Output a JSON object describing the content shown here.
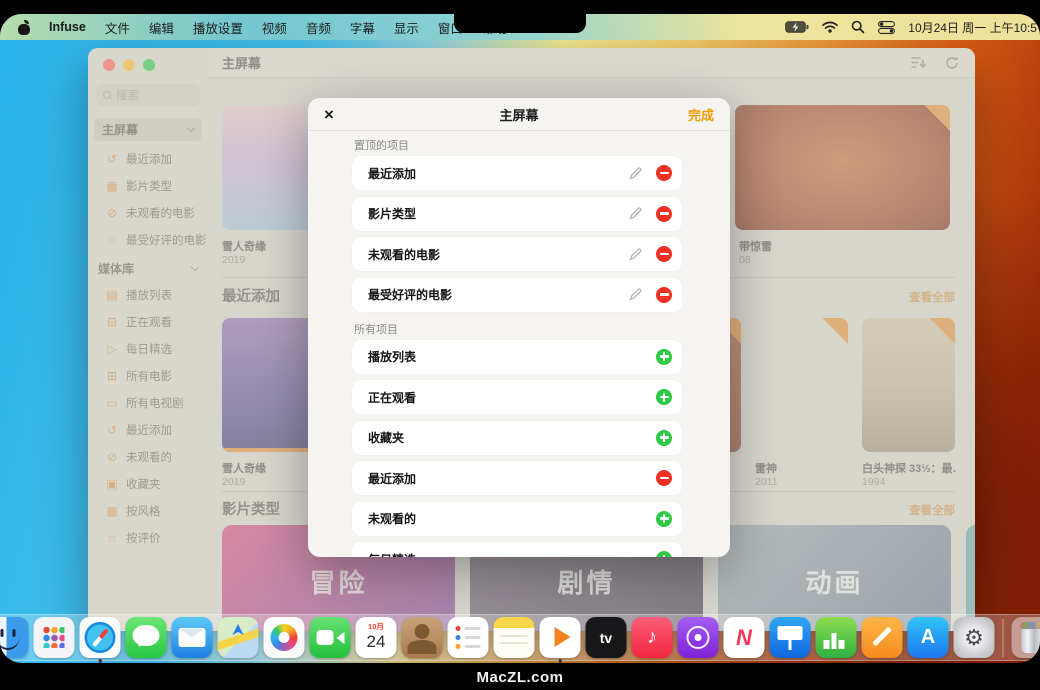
{
  "menu_bar": {
    "app_name": "Infuse",
    "menus": [
      "文件",
      "编辑",
      "播放设置",
      "视频",
      "音频",
      "字幕",
      "显示",
      "窗口",
      "帮助"
    ],
    "clock": "10月24日 周一 上午10:5"
  },
  "window": {
    "title": "主屏幕",
    "sidebar": {
      "search_placeholder": "搜索",
      "home_section": {
        "label": "主屏幕",
        "items": [
          {
            "icon": "clock-icon",
            "glyph": "↺",
            "label": "最近添加"
          },
          {
            "icon": "grid-icon",
            "glyph": "▦",
            "label": "影片类型"
          },
          {
            "icon": "eye-off-icon",
            "glyph": "⊘",
            "label": "未观看的电影"
          },
          {
            "icon": "star-icon",
            "glyph": "☆",
            "label": "最受好评的电影"
          }
        ]
      },
      "library_section": {
        "label": "媒体库",
        "items": [
          {
            "icon": "playlist-icon",
            "glyph": "▤",
            "label": "播放列表"
          },
          {
            "icon": "folder-icon",
            "glyph": "⊟",
            "label": "正在观看"
          },
          {
            "icon": "play-square-icon",
            "glyph": "▷",
            "label": "每日精选"
          },
          {
            "icon": "film-grid-icon",
            "glyph": "⊞",
            "label": "所有电影"
          },
          {
            "icon": "tv-icon",
            "glyph": "▭",
            "label": "所有电视剧"
          },
          {
            "icon": "clock-icon",
            "glyph": "↺",
            "label": "最近添加"
          },
          {
            "icon": "eye-off-icon",
            "glyph": "⊘",
            "label": "未观看的"
          },
          {
            "icon": "favorites-icon",
            "glyph": "▣",
            "label": "收藏夹"
          },
          {
            "icon": "genre-icon",
            "glyph": "▦",
            "label": "按风格"
          },
          {
            "icon": "rating-icon",
            "glyph": "☆",
            "label": "按评价"
          }
        ]
      }
    },
    "content": {
      "featured": [
        {
          "title": "雪人奇缘",
          "year": "2019"
        },
        {
          "title": "带惊雷",
          "year": "08"
        }
      ],
      "recent": {
        "heading": "最近添加",
        "link": "查看全部",
        "items": [
          {
            "title": "雪人奇缘",
            "year": "2019"
          },
          {
            "title": "雷神",
            "year": "2011"
          },
          {
            "title": "白头神探 33⅓：最…",
            "year": "1994"
          }
        ]
      },
      "genres": {
        "heading": "影片类型",
        "link": "查看全部",
        "categories": [
          "冒险",
          "剧情",
          "动画"
        ]
      }
    }
  },
  "modal": {
    "title": "主屏幕",
    "close_glyph": "×",
    "done_label": "完成",
    "pinned_section": "置顶的项目",
    "all_section": "所有项目",
    "pinned_items": [
      {
        "label": "最近添加",
        "action": "remove"
      },
      {
        "label": "影片类型",
        "action": "remove"
      },
      {
        "label": "未观看的电影",
        "action": "remove"
      },
      {
        "label": "最受好评的电影",
        "action": "remove"
      }
    ],
    "all_items": [
      {
        "label": "播放列表",
        "action": "add"
      },
      {
        "label": "正在观看",
        "action": "add"
      },
      {
        "label": "收藏夹",
        "action": "add"
      },
      {
        "label": "最近添加",
        "action": "remove"
      },
      {
        "label": "未观看的",
        "action": "add"
      },
      {
        "label": "每日精选",
        "action": "add"
      }
    ]
  },
  "dock": {
    "apps": [
      "Finder",
      "Launchpad",
      "Safari",
      "Messages",
      "Mail",
      "Maps",
      "Photos",
      "FaceTime",
      "Calendar",
      "Contacts",
      "Reminders",
      "Notes",
      "Infuse",
      "TV",
      "Music",
      "Podcasts",
      "News",
      "Keynote",
      "Numbers",
      "Pages",
      "App Store",
      "System Settings",
      "Trash"
    ],
    "running": [
      "Finder",
      "Safari",
      "Infuse"
    ],
    "calendar": {
      "month": "10月",
      "day": "24"
    },
    "tv_label": "tv",
    "music_glyph": "♪",
    "news_glyph": "N",
    "appstore_glyph": "A",
    "settings_glyph": "⚙"
  },
  "watermark": "MacZL.com",
  "colors": {
    "accent_orange": "#f59b00",
    "remove_red": "#ee3124",
    "add_green": "#2fc946",
    "sidebar_icon_orange": "#dd9140"
  }
}
